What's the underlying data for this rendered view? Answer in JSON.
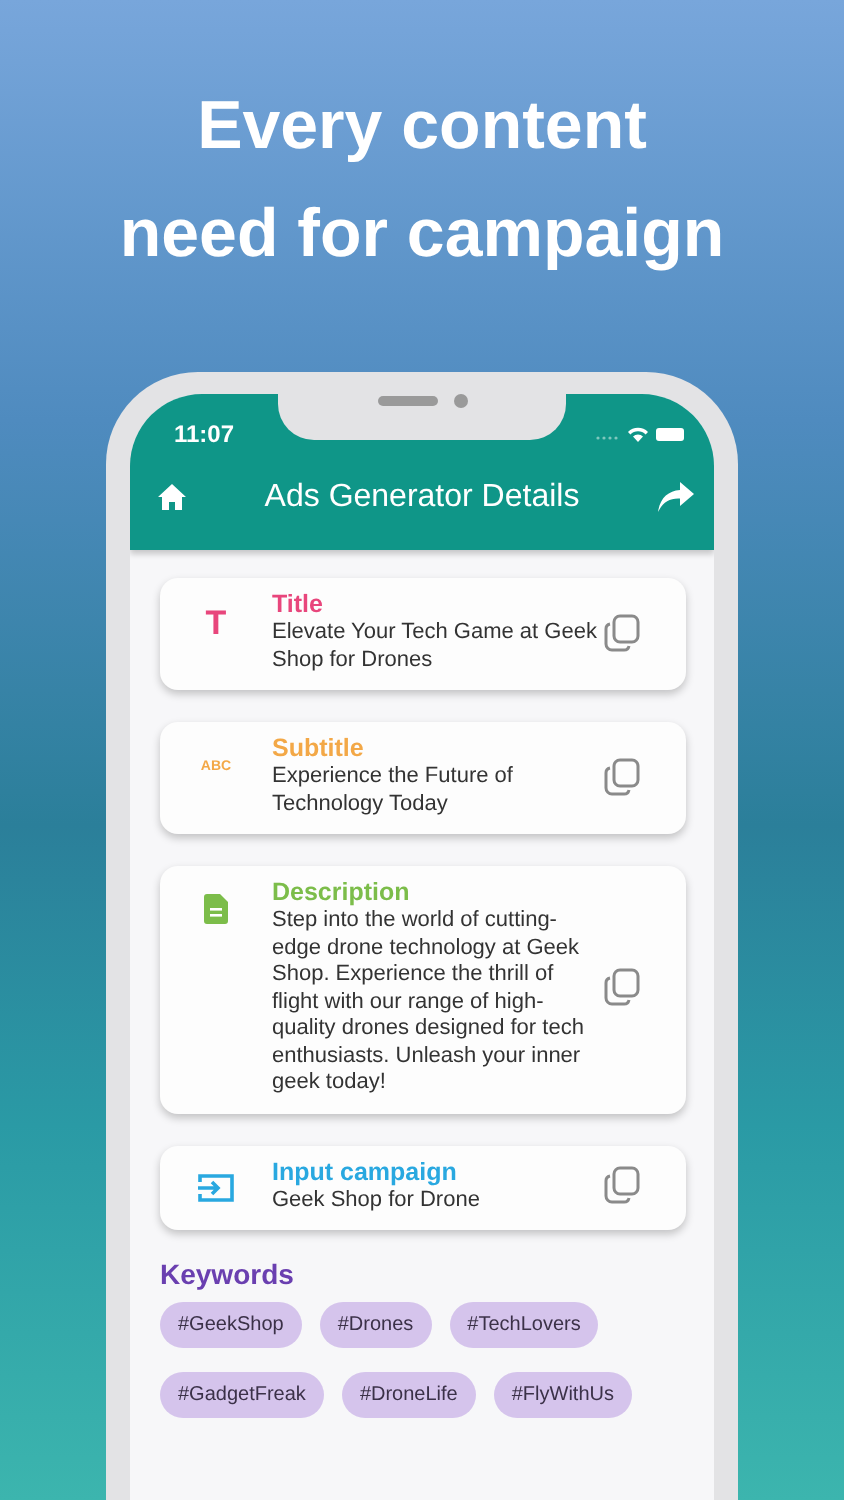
{
  "headline": [
    "Every content",
    "need for campaign"
  ],
  "status_bar": {
    "time": "11:07"
  },
  "app_bar": {
    "title": "Ads Generator Details"
  },
  "cards": [
    {
      "kind": "title",
      "glyph": "T",
      "label": "Title",
      "color": "#e8467c",
      "text": "Elevate Your Tech Game at Geek Shop for Drones"
    },
    {
      "kind": "subtitle",
      "glyph": "ABC",
      "label": "Subtitle",
      "color": "#f3a847",
      "text": "Experience the Future of Technology Today"
    },
    {
      "kind": "description",
      "label": "Description",
      "color": "#7cbd4a",
      "text": "Step into the world of cutting-edge drone technology at Geek Shop. Experience the thrill of flight with our range of high-quality drones designed for tech enthusiasts. Unleash your inner geek today!"
    },
    {
      "kind": "input",
      "label": "Input campaign",
      "color": "#29a8e0",
      "text": "Geek Shop for Drone"
    }
  ],
  "keywords": {
    "heading": "Keywords",
    "tags": [
      "#GeekShop",
      "#Drones",
      "#TechLovers",
      "#GadgetFreak",
      "#DroneLife",
      "#FlyWithUs"
    ]
  }
}
